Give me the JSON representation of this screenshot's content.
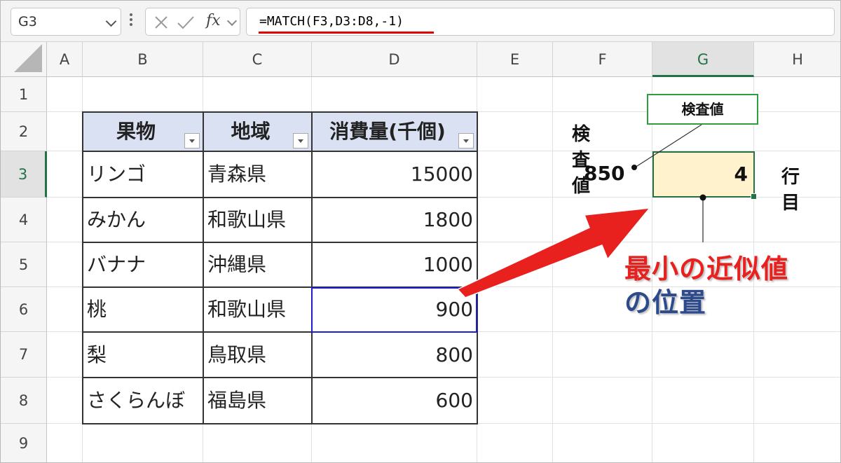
{
  "formula_bar": {
    "name_box": "G3",
    "fx_label": "fx",
    "formula": "=MATCH(F3,D3:D8,-1)"
  },
  "columns": [
    "A",
    "B",
    "C",
    "D",
    "E",
    "F",
    "G",
    "H"
  ],
  "rows": [
    "1",
    "2",
    "3",
    "4",
    "5",
    "6",
    "7",
    "8",
    "9"
  ],
  "selected_cell": {
    "column": "G",
    "row": "3"
  },
  "table": {
    "headers": [
      "果物",
      "地域",
      "消費量(千個)"
    ],
    "rows": [
      [
        "リンゴ",
        "青森県",
        "15000"
      ],
      [
        "みかん",
        "和歌山県",
        "1800"
      ],
      [
        "バナナ",
        "沖縄県",
        "1000"
      ],
      [
        "桃",
        "和歌山県",
        "900"
      ],
      [
        "梨",
        "鳥取県",
        "800"
      ],
      [
        "さくらんぼ",
        "福島県",
        "600"
      ]
    ]
  },
  "lookup": {
    "label": "検査値",
    "value": "850",
    "result": "4",
    "result_suffix": "行目",
    "callout": "検査値"
  },
  "annotation": {
    "line1": "最小の近似値",
    "line2": "の位置"
  },
  "colors": {
    "header_fill": "#d9e1f2",
    "result_fill": "#fff2cc",
    "excel_green": "#217346",
    "highlight_blue": "#1c1cd0",
    "arrow_red": "#e8201e",
    "caption_blue": "#2c4a8c"
  }
}
